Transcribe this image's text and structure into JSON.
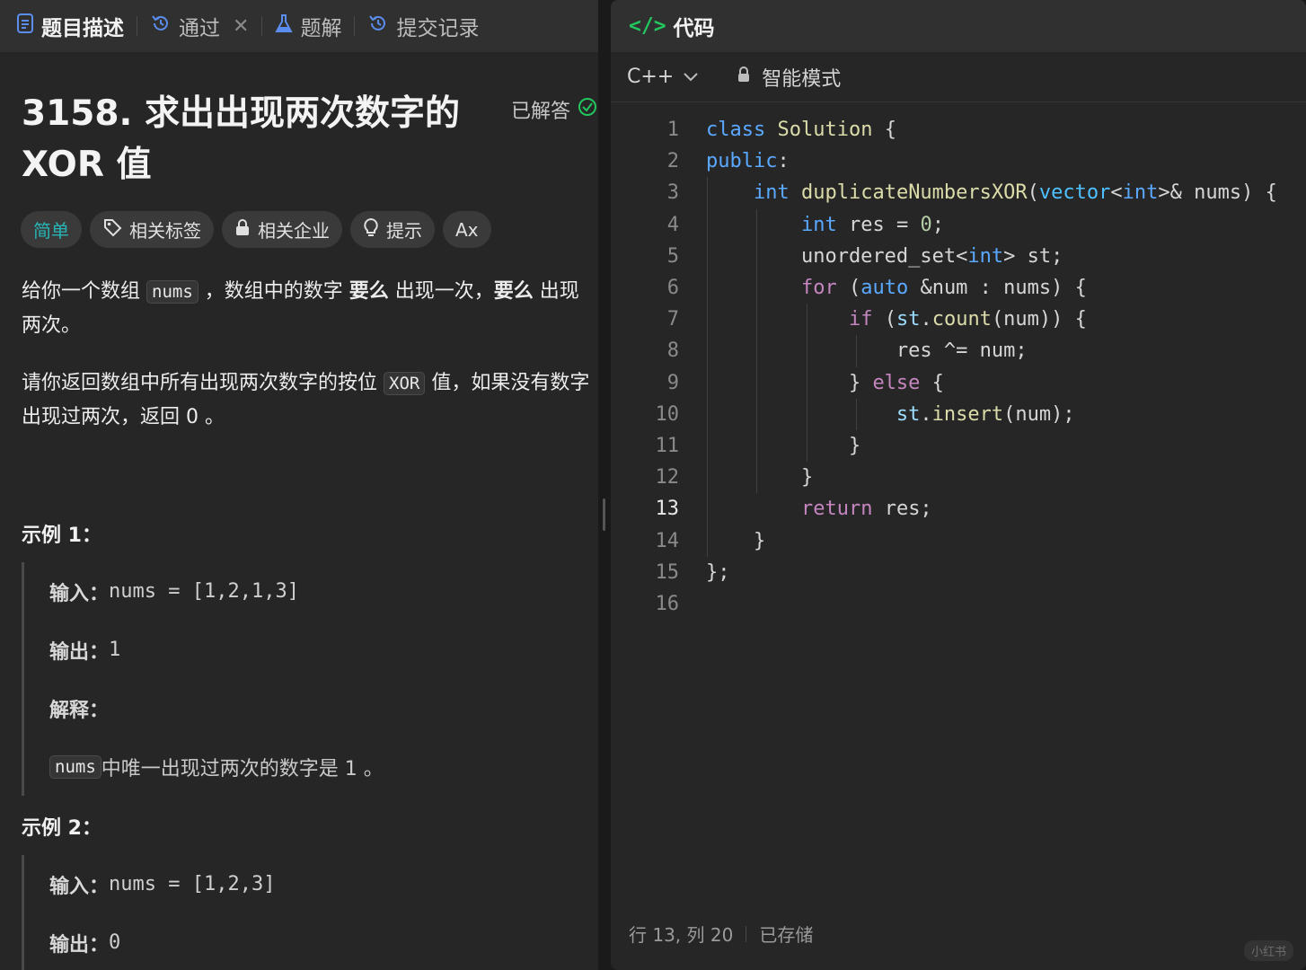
{
  "tabs": [
    {
      "label": "题目描述",
      "icon": "document-icon",
      "active": true
    },
    {
      "label": "通过",
      "icon": "history-icon",
      "closable": true
    },
    {
      "label": "题解",
      "icon": "flask-icon"
    },
    {
      "label": "提交记录",
      "icon": "history-icon"
    }
  ],
  "problem": {
    "title": "3158. 求出出现两次数字的 XOR 值",
    "status": "已解答",
    "tags": [
      {
        "label": "简单",
        "kind": "easy"
      },
      {
        "label": "相关标签",
        "icon": "tag-icon"
      },
      {
        "label": "相关企业",
        "icon": "lock-icon"
      },
      {
        "label": "提示",
        "icon": "lightbulb-icon"
      },
      {
        "label": "Ax",
        "icon": "font-size-icon"
      }
    ],
    "para1": {
      "t1": "给你一个数组 ",
      "code": "nums",
      "t2": " ，数组中的数字 ",
      "b1": "要么",
      "t3": " 出现一次，",
      "b2": "要么",
      "t4": " 出现两次。"
    },
    "para2": {
      "t1": "请你返回数组中所有出现两次数字的按位 ",
      "code": "XOR",
      "t2": " 值，如果没有数字出现过两次，返回 0 。"
    },
    "example1": {
      "title": "示例 1：",
      "input_label": "输入：",
      "input": "nums = [1,2,1,3]",
      "output_label": "输出：",
      "output": "1",
      "explain_label": "解释：",
      "explain_code": "nums",
      "explain_text": " 中唯一出现过两次的数字是 1 。"
    },
    "example2": {
      "title": "示例 2：",
      "input_label": "输入：",
      "input": "nums = [1,2,3]",
      "output_label": "输出：",
      "output": "0"
    }
  },
  "editor": {
    "panel_title": "代码",
    "language": "C++",
    "mode": "智能模式",
    "current_line": 13,
    "status_position": "行 13, 列 20",
    "status_saved": "已存储",
    "watermark": "小红书"
  },
  "code_lines": [
    "class Solution {",
    "public:",
    "    int duplicateNumbersXOR(vector<int>& nums) {",
    "        int res = 0;",
    "        unordered_set<int> st;",
    "        for (auto &num : nums) {",
    "            if (st.count(num)) {",
    "                res ^= num;",
    "            } else {",
    "                st.insert(num);",
    "            }",
    "        }",
    "        return res;",
    "    }",
    "};",
    ""
  ]
}
